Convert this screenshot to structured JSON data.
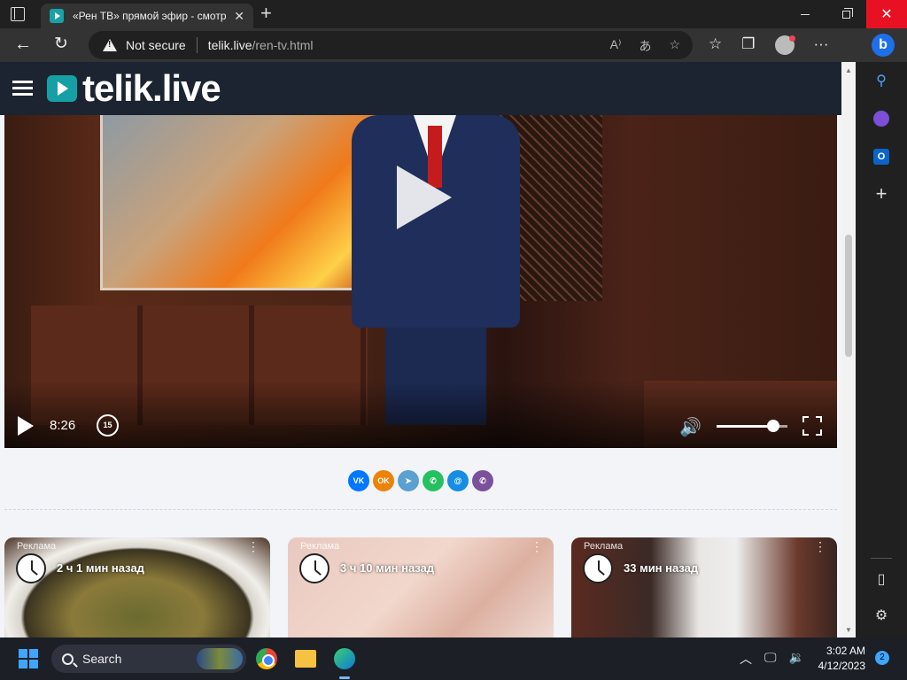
{
  "browser": {
    "tab": {
      "title": "«Рен ТВ» прямой эфир - смотре",
      "close": "✕"
    },
    "new_tab": "+",
    "window_controls": {
      "close": "✕"
    },
    "address": {
      "security_label": "Not secure",
      "host": "telik.live",
      "path": "/ren-tv.html"
    },
    "omni_icons": [
      "read-aloud-icon",
      "translate-icon",
      "add-favorite-icon"
    ],
    "toolbar_icons": [
      "favorites-icon",
      "collections-icon",
      "profile-icon",
      "more-icon"
    ],
    "more_label": "···",
    "bing_label": "b"
  },
  "edge_sidebar": {
    "search": "⚲",
    "outlook": "O",
    "add": "+",
    "panel": "▯",
    "settings": "⚙"
  },
  "site": {
    "logo_text": "telik.live",
    "accent": "#16a0a5"
  },
  "player": {
    "time": "8:26",
    "rewind_label": "15",
    "volume": 0.8
  },
  "share": [
    {
      "name": "vk",
      "label": "VK",
      "color": "#0077ff"
    },
    {
      "name": "ok",
      "label": "OK",
      "color": "#ee8208"
    },
    {
      "name": "telegram",
      "label": "➤",
      "color": "#5aa0d0"
    },
    {
      "name": "whatsapp",
      "label": "✆",
      "color": "#25c160"
    },
    {
      "name": "moimir",
      "label": "@",
      "color": "#168de2"
    },
    {
      "name": "viber",
      "label": "✆",
      "color": "#7b519d"
    }
  ],
  "ads": [
    {
      "label": "Реклама",
      "ago": "2 ч 1 мин назад"
    },
    {
      "label": "Реклама",
      "ago": "3 ч 10 мин назад"
    },
    {
      "label": "Реклама",
      "ago": "33 мин назад"
    }
  ],
  "taskbar": {
    "search_label": "Search",
    "time": "3:02 AM",
    "date": "4/12/2023",
    "notifications": "2"
  }
}
